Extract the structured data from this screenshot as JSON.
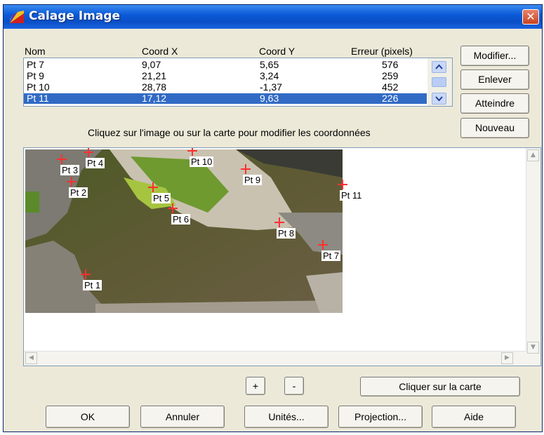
{
  "window": {
    "title": "Calage Image",
    "close": "✕"
  },
  "table": {
    "headers": {
      "nom": "Nom",
      "x": "Coord X",
      "y": "Coord Y",
      "err": "Erreur (pixels)"
    },
    "rows": [
      {
        "nom": "Pt 7",
        "x": "9,07",
        "y": "5,65",
        "err": "576"
      },
      {
        "nom": "Pt 9",
        "x": "21,21",
        "y": "3,24",
        "err": "259"
      },
      {
        "nom": "Pt 10",
        "x": "28,78",
        "y": "-1,37",
        "err": "452"
      },
      {
        "nom": "Pt 11",
        "x": "17,12",
        "y": "9,63",
        "err": "226"
      }
    ],
    "selected_index": 3
  },
  "buttons": {
    "modifier": "Modifier...",
    "enlever": "Enlever",
    "atteindre": "Atteindre",
    "nouveau": "Nouveau",
    "plus": "+",
    "minus": "-",
    "cliquer_carte": "Cliquer sur la carte",
    "ok": "OK",
    "annuler": "Annuler",
    "unites": "Unités...",
    "projection": "Projection...",
    "aide": "Aide"
  },
  "instruction": "Cliquez sur l'image ou sur la carte pour modifier les coordonnées",
  "points": [
    {
      "label": "Pt 1"
    },
    {
      "label": "Pt 2"
    },
    {
      "label": "Pt 3"
    },
    {
      "label": "Pt 4"
    },
    {
      "label": "Pt 5"
    },
    {
      "label": "Pt 6"
    },
    {
      "label": "Pt 7"
    },
    {
      "label": "Pt 8"
    },
    {
      "label": "Pt 9"
    },
    {
      "label": "Pt 10"
    },
    {
      "label": "Pt 11"
    }
  ],
  "colors": {
    "title_bar": "#0b5ad8",
    "selection": "#316ac5",
    "marker": "#ff3030",
    "close": "#c94321"
  }
}
